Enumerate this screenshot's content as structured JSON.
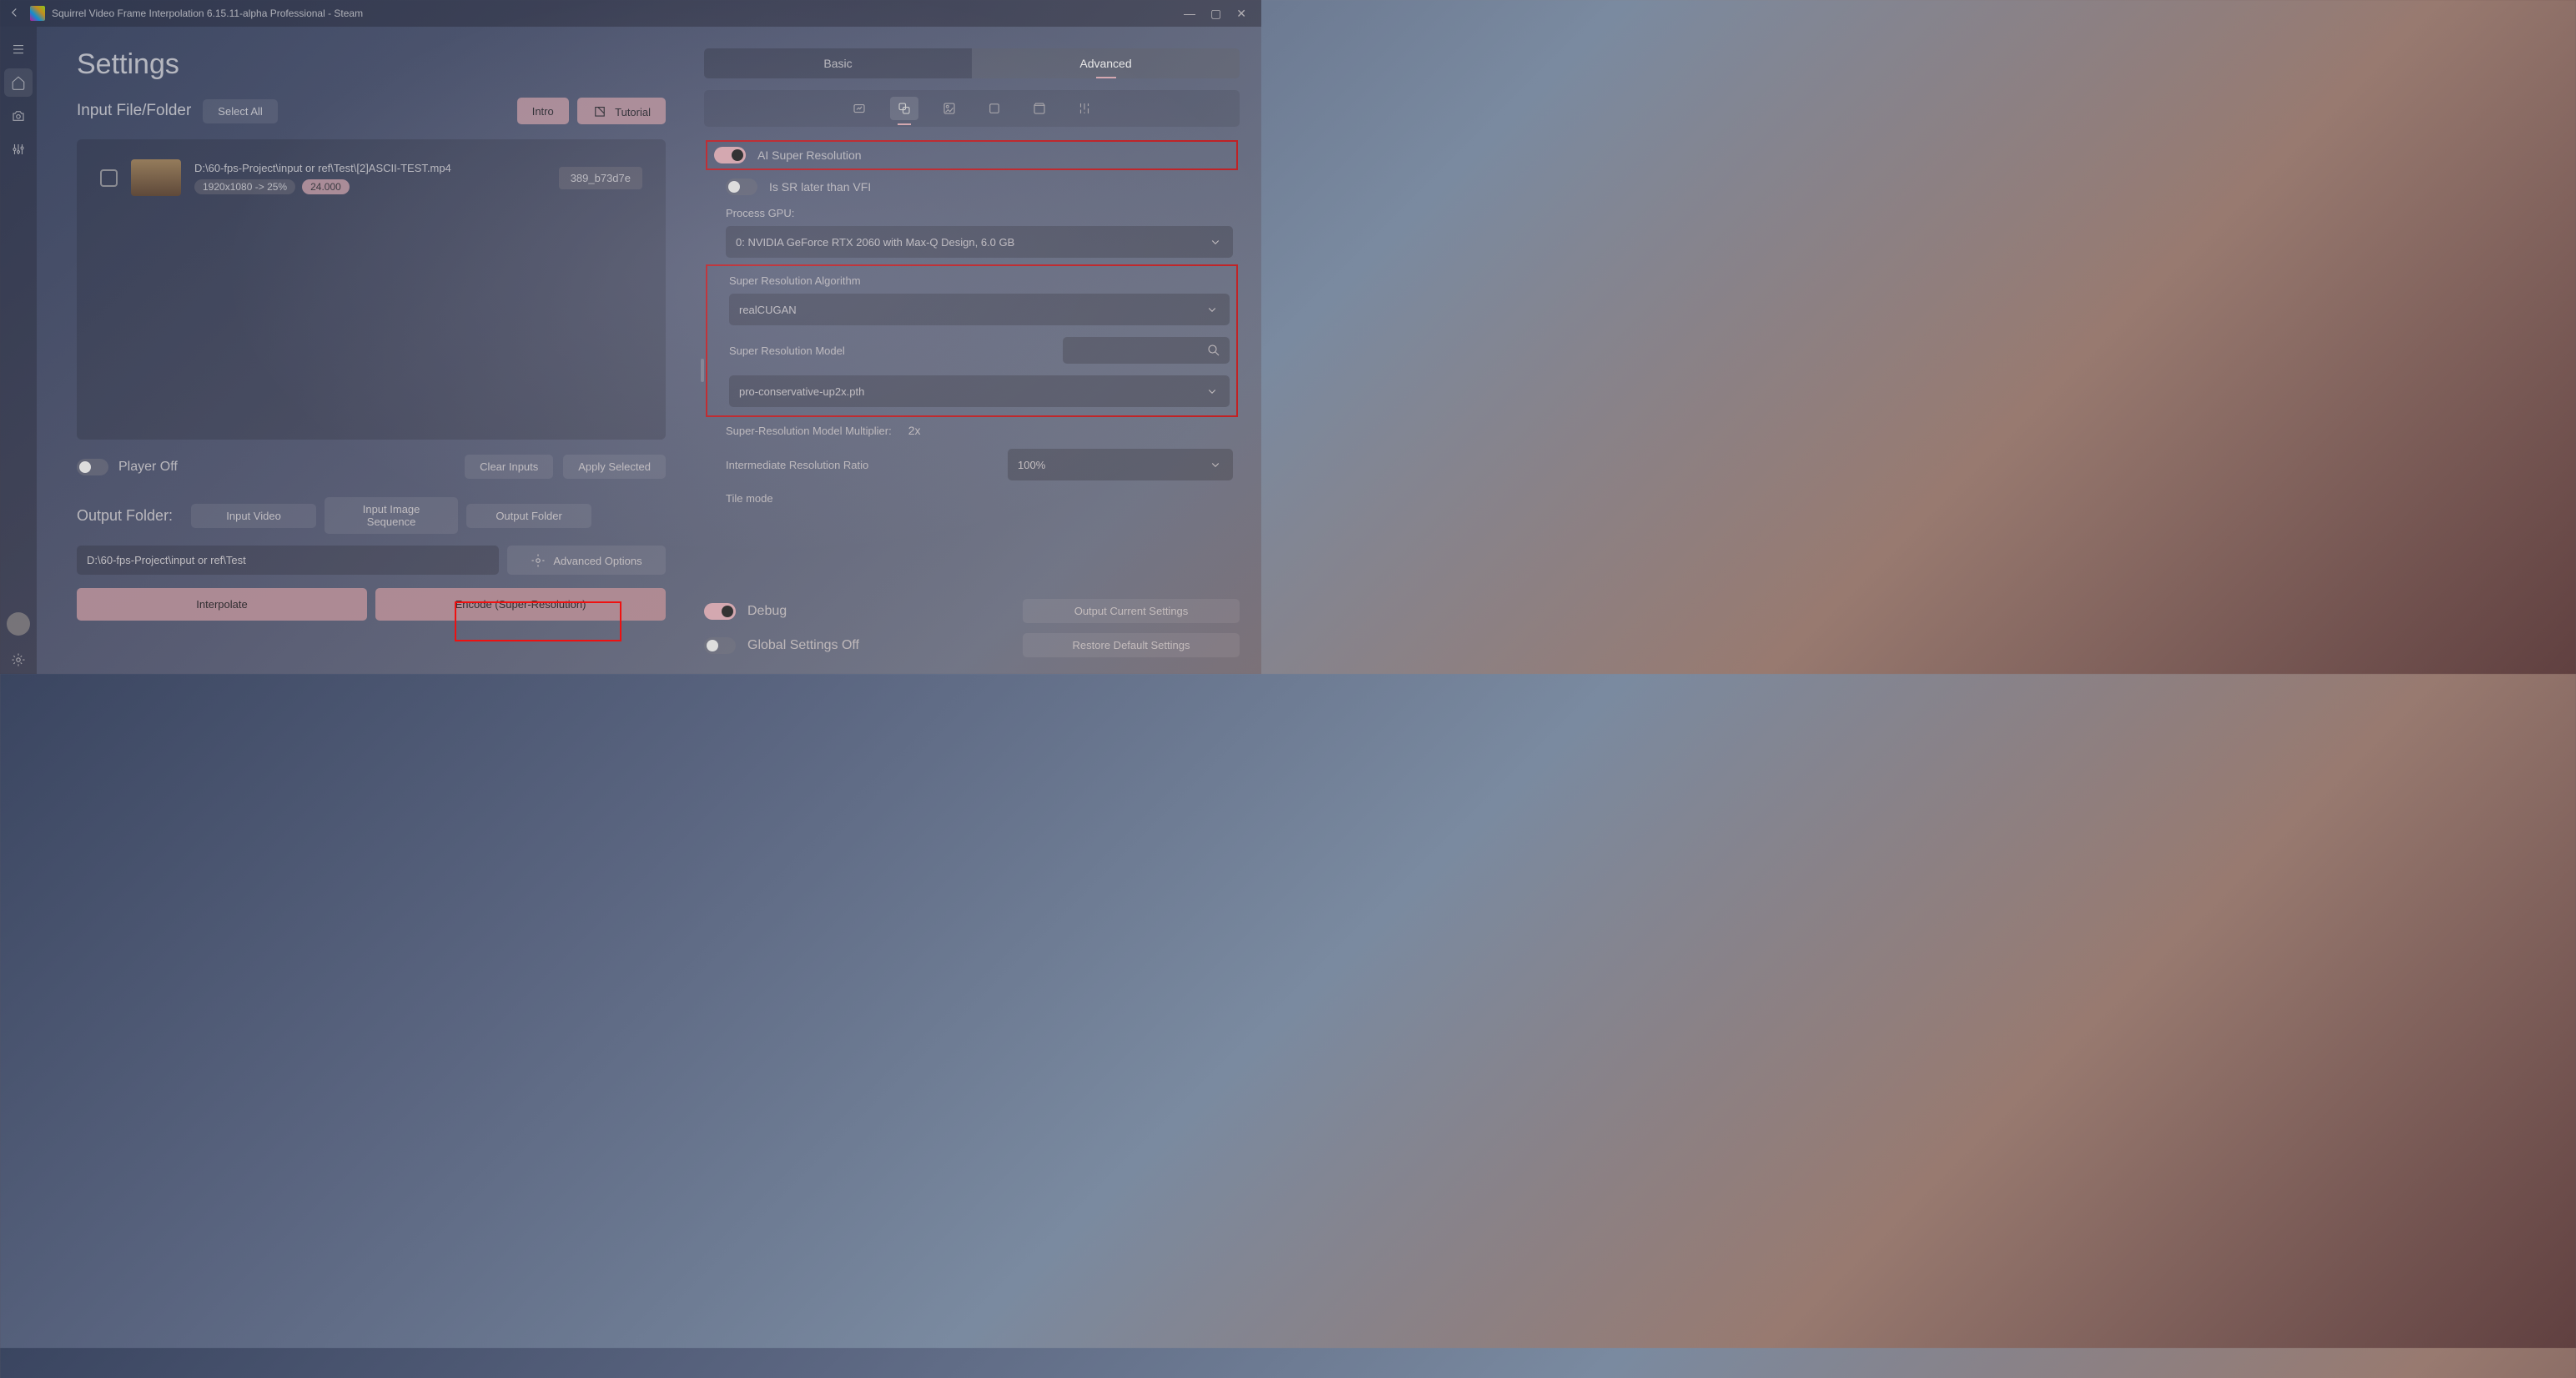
{
  "titlebar": {
    "title": "Squirrel Video Frame Interpolation 6.15.11-alpha  Professional - Steam"
  },
  "leftPanel": {
    "settingsTitle": "Settings",
    "inputLabel": "Input File/Folder",
    "selectAll": "Select All",
    "intro": "Intro",
    "tutorial": "Tutorial",
    "file": {
      "path": "D:\\60-fps-Project\\input or ref\\Test\\[2]ASCII-TEST.mp4",
      "resBadge": "1920x1080 -> 25%",
      "fpsBadge": "24.000",
      "tag": "389_b73d7e"
    },
    "playerOff": "Player Off",
    "clearInputs": "Clear Inputs",
    "applySelected": "Apply Selected",
    "outputFolderLabel": "Output Folder:",
    "inputVideo": "Input Video",
    "inputImageSeq": "Input Image Sequence",
    "outputFolder": "Output Folder",
    "outputPath": "D:\\60-fps-Project\\input or ref\\Test",
    "advOptions": "Advanced Options",
    "interpolate": "Interpolate",
    "encode": "Encode (Super-Resolution)"
  },
  "rightPanel": {
    "tabBasic": "Basic",
    "tabAdvanced": "Advanced",
    "aiSR": "AI Super Resolution",
    "srLater": "Is SR later than VFI",
    "processGPU": "Process GPU:",
    "gpuValue": "0: NVIDIA GeForce RTX 2060 with Max-Q Design, 6.0 GB",
    "srAlgo": "Super Resolution Algorithm",
    "srAlgoValue": "realCUGAN",
    "srModel": "Super Resolution Model",
    "srModelValue": "pro-conservative-up2x.pth",
    "multiplier": "Super-Resolution Model Multiplier:",
    "multiplierValue": "2x",
    "interRatio": "Intermediate Resolution Ratio",
    "interRatioValue": "100%",
    "tileMode": "Tile mode",
    "debug": "Debug",
    "globalOff": "Global Settings Off",
    "outputSettings": "Output Current Settings",
    "restoreDefault": "Restore Default Settings"
  }
}
